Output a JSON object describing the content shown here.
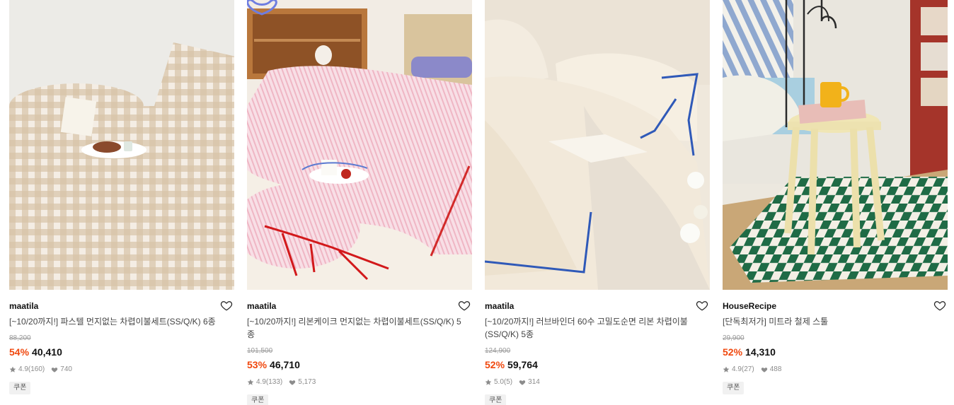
{
  "products": [
    {
      "brand": "maatila",
      "title": "[~10/20까지!] 파스텔 먼지없는 차렵이불세트(SS/Q/K) 6종",
      "original_price": "88,200",
      "discount": "54%",
      "price": "40,410",
      "rating": "4.9",
      "reviews": "(160)",
      "likes": "740",
      "badge": "쿠폰"
    },
    {
      "brand": "maatila",
      "title": "[~10/20까지!] 리본케이크 먼지없는 차렵이불세트(SS/Q/K) 5종",
      "original_price": "101,500",
      "discount": "53%",
      "price": "46,710",
      "rating": "4.9",
      "reviews": "(133)",
      "likes": "5,173",
      "badge": "쿠폰"
    },
    {
      "brand": "maatila",
      "title": "[~10/20까지!] 러브바인더 60수 고밀도순면 리본 차렵이불(SS/Q/K) 5종",
      "original_price": "124,900",
      "discount": "52%",
      "price": "59,764",
      "rating": "5.0",
      "reviews": "(5)",
      "likes": "314",
      "badge": "쿠폰"
    },
    {
      "brand": "HouseRecipe",
      "title": "[단독최저가] 미트라 철제 스툴",
      "original_price": "29,900",
      "discount": "52%",
      "price": "14,310",
      "rating": "4.9",
      "reviews": "(27)",
      "likes": "488",
      "badge": "쿠폰"
    }
  ],
  "icons": {
    "like": "heart-outline-icon",
    "star": "star-icon",
    "likes_count": "heart-filled-icon"
  },
  "colors": {
    "discount": "#f0480e",
    "text": "#111111",
    "muted": "#8c8c8c",
    "badge_bg": "#f1f1f1"
  }
}
